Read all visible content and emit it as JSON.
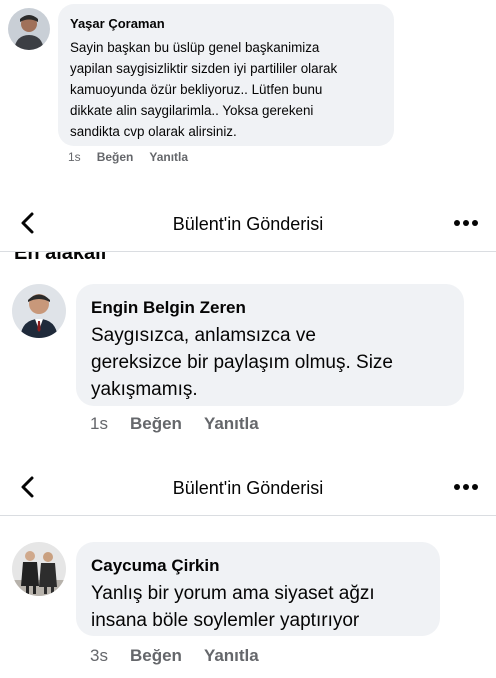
{
  "comments": [
    {
      "author": "Yaşar Çoraman",
      "text": "Sayin başkan bu üslüp genel başkanimiza\nyapilan saygisizliktir sizden iyi partililer olarak\nkamuoyunda özür bekliyoruz.. Lütfen bunu\ndikkate alin saygilarimla.. Yoksa gerekeni\nsandikta cvp olarak alirsiniz.",
      "time": "1s",
      "like": "Beğen",
      "reply": "Yanıtla"
    },
    {
      "author": "Engin Belgin Zeren",
      "text": "Saygısızca, anlamsızca ve\ngereksizce bir paylaşım olmuş. Size\nyakışmamış.",
      "time": "1s",
      "like": "Beğen",
      "reply": "Yanıtla"
    },
    {
      "author": "Caycuma Çirkin",
      "text": "Yanlış bir yorum ama siyaset ağzı\ninsana böle soylemler yaptırıyor",
      "time": "3s",
      "like": "Beğen",
      "reply": "Yanıtla"
    }
  ],
  "headers": [
    {
      "title": "Bülent'in Gönderisi"
    },
    {
      "title": "Bülent'in Gönderisi"
    }
  ],
  "section_heading": "En alakalı",
  "icons": {
    "back": "chevron-left-icon",
    "more": "more-horizontal-icon"
  },
  "colors": {
    "bubble": "#f0f2f5",
    "meta": "#65676b",
    "text": "#050505"
  }
}
